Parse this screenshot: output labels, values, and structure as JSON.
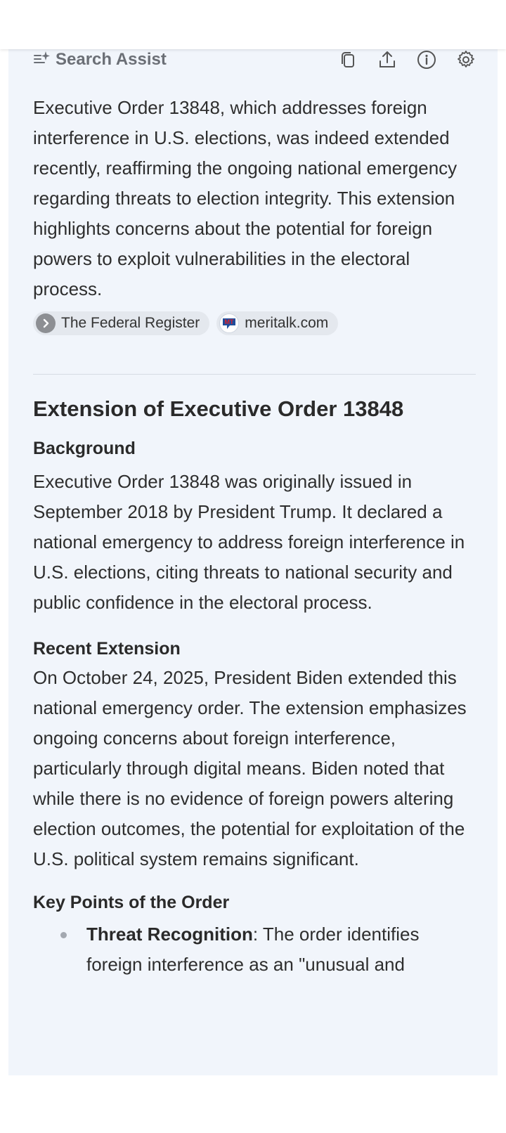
{
  "assist": {
    "title": "Search Assist",
    "summary": "Executive Order 13848, which addresses foreign interference in U.S. elections, was indeed extended recently, reaffirming the ongoing national emergency regarding threats to election integrity. This extension highlights concerns about the potential for foreign powers to exploit vulnerabilities in the electoral process.",
    "sources": [
      {
        "label": "The Federal Register",
        "icon": "chevron-right-icon"
      },
      {
        "label": "meritalk.com",
        "icon": "meritalk-logo-icon"
      }
    ],
    "toolbar": [
      "copy-icon",
      "share-icon",
      "info-icon",
      "settings-icon"
    ]
  },
  "article": {
    "heading": "Extension of Executive Order 13848",
    "background_heading": "Background",
    "background_text": "Executive Order 13848 was originally issued in September 2018 by President Trump. It declared a national emergency to address foreign interference in U.S. elections, citing threats to national security and public confidence in the electoral process.",
    "recent_heading": "Recent Extension",
    "recent_text": "On October 24, 2025, President Biden extended this national emergency order. The extension emphasizes ongoing concerns about foreign interference, particularly through digital means. Biden noted that while there is no evidence of foreign powers altering election outcomes, the potential for exploitation of the U.S. political system remains significant.",
    "keypoints_heading": "Key Points of the Order",
    "points": [
      {
        "term": "Threat Recognition",
        "text": ": The order identifies foreign interference as an \"unusual and"
      }
    ]
  },
  "colors": {
    "panel_bg": "#f1f5fb",
    "chip_bg": "#e4e8ee",
    "muted_text": "#6b6f76"
  }
}
